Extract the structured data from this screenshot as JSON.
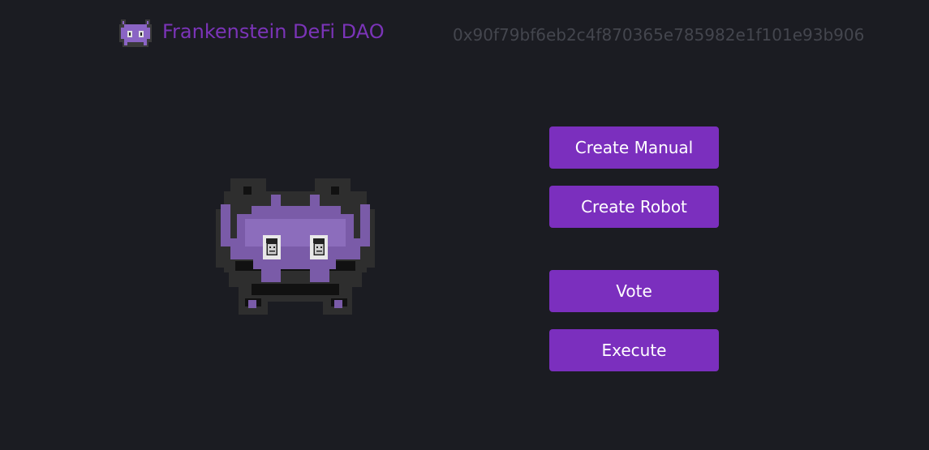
{
  "header": {
    "logo_icon": "purple-space-invader-icon",
    "title": "Frankenstein DeFi DAO",
    "wallet_address": "0x90f79bf6eb2c4f870365e785982e1f101e93b906"
  },
  "hero": {
    "icon": "space-invader-with-frankenstein-eyes-icon"
  },
  "actions": {
    "create_manual": "Create Manual",
    "create_robot": "Create Robot",
    "vote": "Vote",
    "execute": "Execute"
  },
  "colors": {
    "background": "#1b1c22",
    "accent": "#7b2fbe",
    "title": "#7b34b8",
    "address": "#44464e"
  }
}
